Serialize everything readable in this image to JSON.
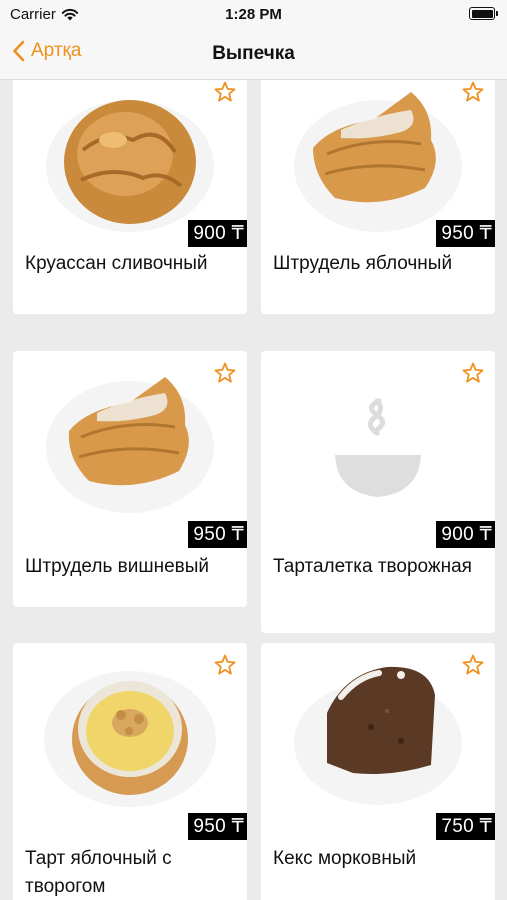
{
  "status": {
    "carrier": "Carrier",
    "time": "1:28 PM"
  },
  "nav": {
    "back_label": "Артқа",
    "title": "Выпечка"
  },
  "products": [
    {
      "name": "Круассан сливочный",
      "price": "900 ₸",
      "image": "croissant"
    },
    {
      "name": "Штрудель яблочный",
      "price": "950 ₸",
      "image": "strudel"
    },
    {
      "name": "Штрудель вишневый",
      "price": "950 ₸",
      "image": "strudel"
    },
    {
      "name": "Тарталетка творожная",
      "price": "900 ₸",
      "image": "placeholder-bowl-icon"
    },
    {
      "name": "Тарт яблочный с творогом",
      "price": "950 ₸",
      "image": "tart"
    },
    {
      "name": "Кекс морковный",
      "price": "750 ₸",
      "image": "carrot-cake"
    }
  ],
  "colors": {
    "accent": "#f0901e",
    "background": "#ebebeb",
    "card": "#ffffff",
    "price_tag": "#000000"
  }
}
